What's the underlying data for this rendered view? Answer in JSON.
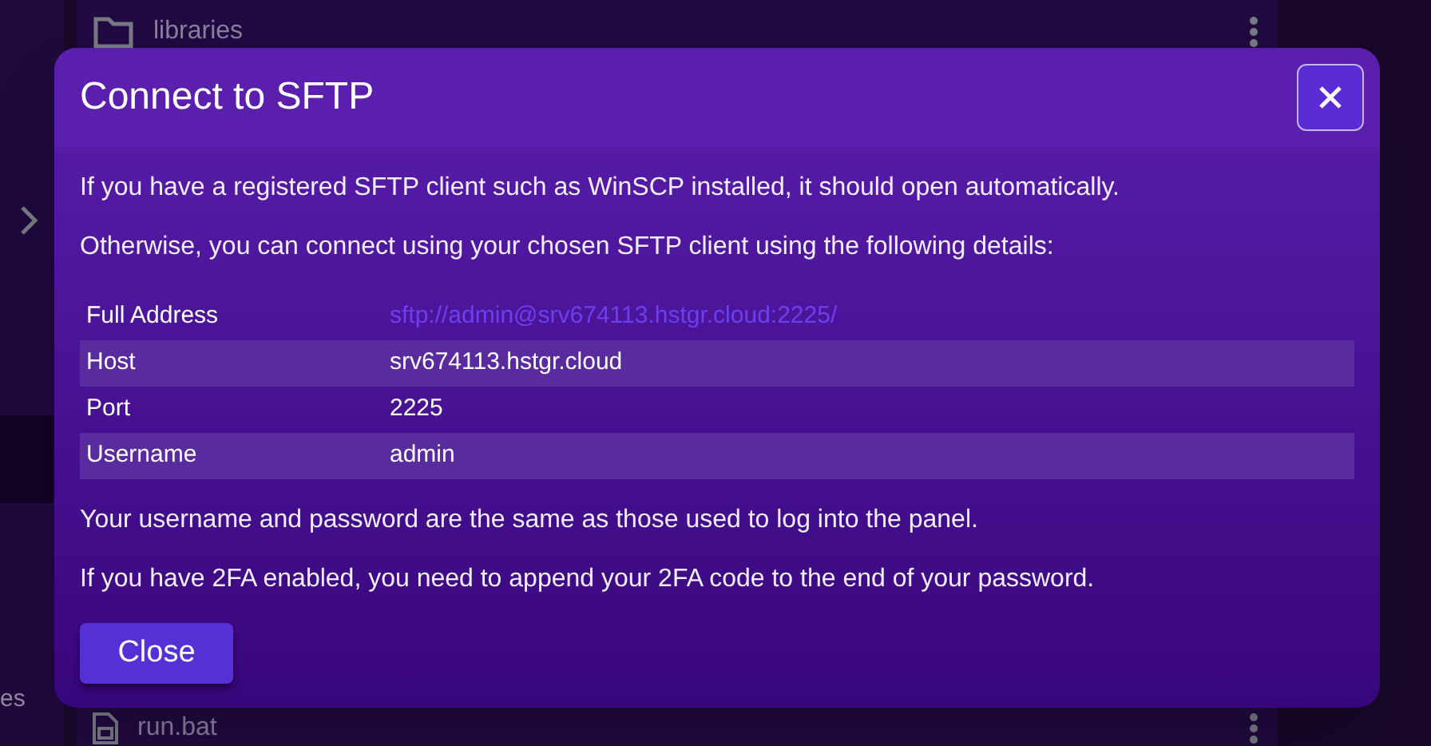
{
  "background": {
    "sidebar_text": "es",
    "files": [
      {
        "name": "libraries",
        "kind": "folder"
      },
      {
        "name": "run.bat",
        "kind": "file"
      }
    ]
  },
  "dialog": {
    "title": "Connect to SFTP",
    "intro": [
      "If you have a registered SFTP client such as WinSCP installed, it should open automatically.",
      "Otherwise, you can connect using your chosen SFTP client using the following details:"
    ],
    "details": [
      {
        "label": "Full Address",
        "value": "sftp://admin@srv674113.hstgr.cloud:2225/",
        "kind": "link"
      },
      {
        "label": "Host",
        "value": "srv674113.hstgr.cloud",
        "kind": "text"
      },
      {
        "label": "Port",
        "value": "2225",
        "kind": "text"
      },
      {
        "label": "Username",
        "value": "admin",
        "kind": "text"
      }
    ],
    "notes": [
      "Your username and password are the same as those used to log into the panel.",
      "If you have 2FA enabled, you need to append your 2FA code to the end of your password."
    ],
    "button": "Close"
  }
}
